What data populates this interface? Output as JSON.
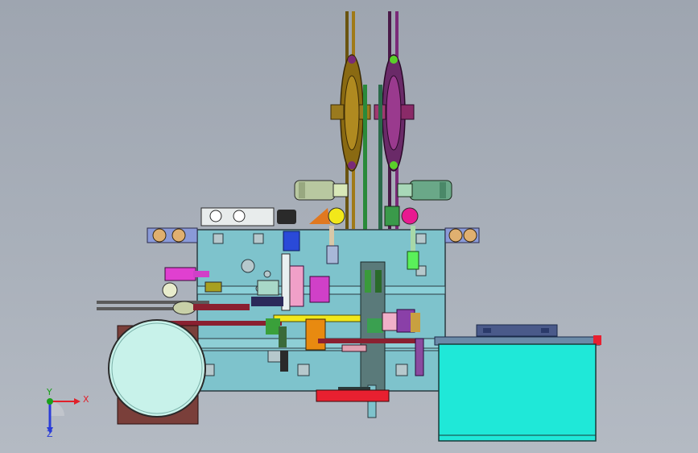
{
  "viewport": {
    "background_top": "#9ea5b0",
    "background_bottom": "#b4bac3"
  },
  "triad": {
    "x_label": "X",
    "y_label": "Y",
    "z_label": "Z",
    "x_color": "#e0202a",
    "y_color": "#1aa01a",
    "z_color": "#2a3cd8"
  },
  "colors": {
    "frame": "#7ec3cc",
    "tray": "#1fe8d8",
    "bowl": "#c8f2ea",
    "bowl_base": "#7a3f3a",
    "wheel_left": "#a07a18",
    "wheel_right": "#7a2a78",
    "track": "#f2e81a",
    "bar": "#8a2030"
  }
}
